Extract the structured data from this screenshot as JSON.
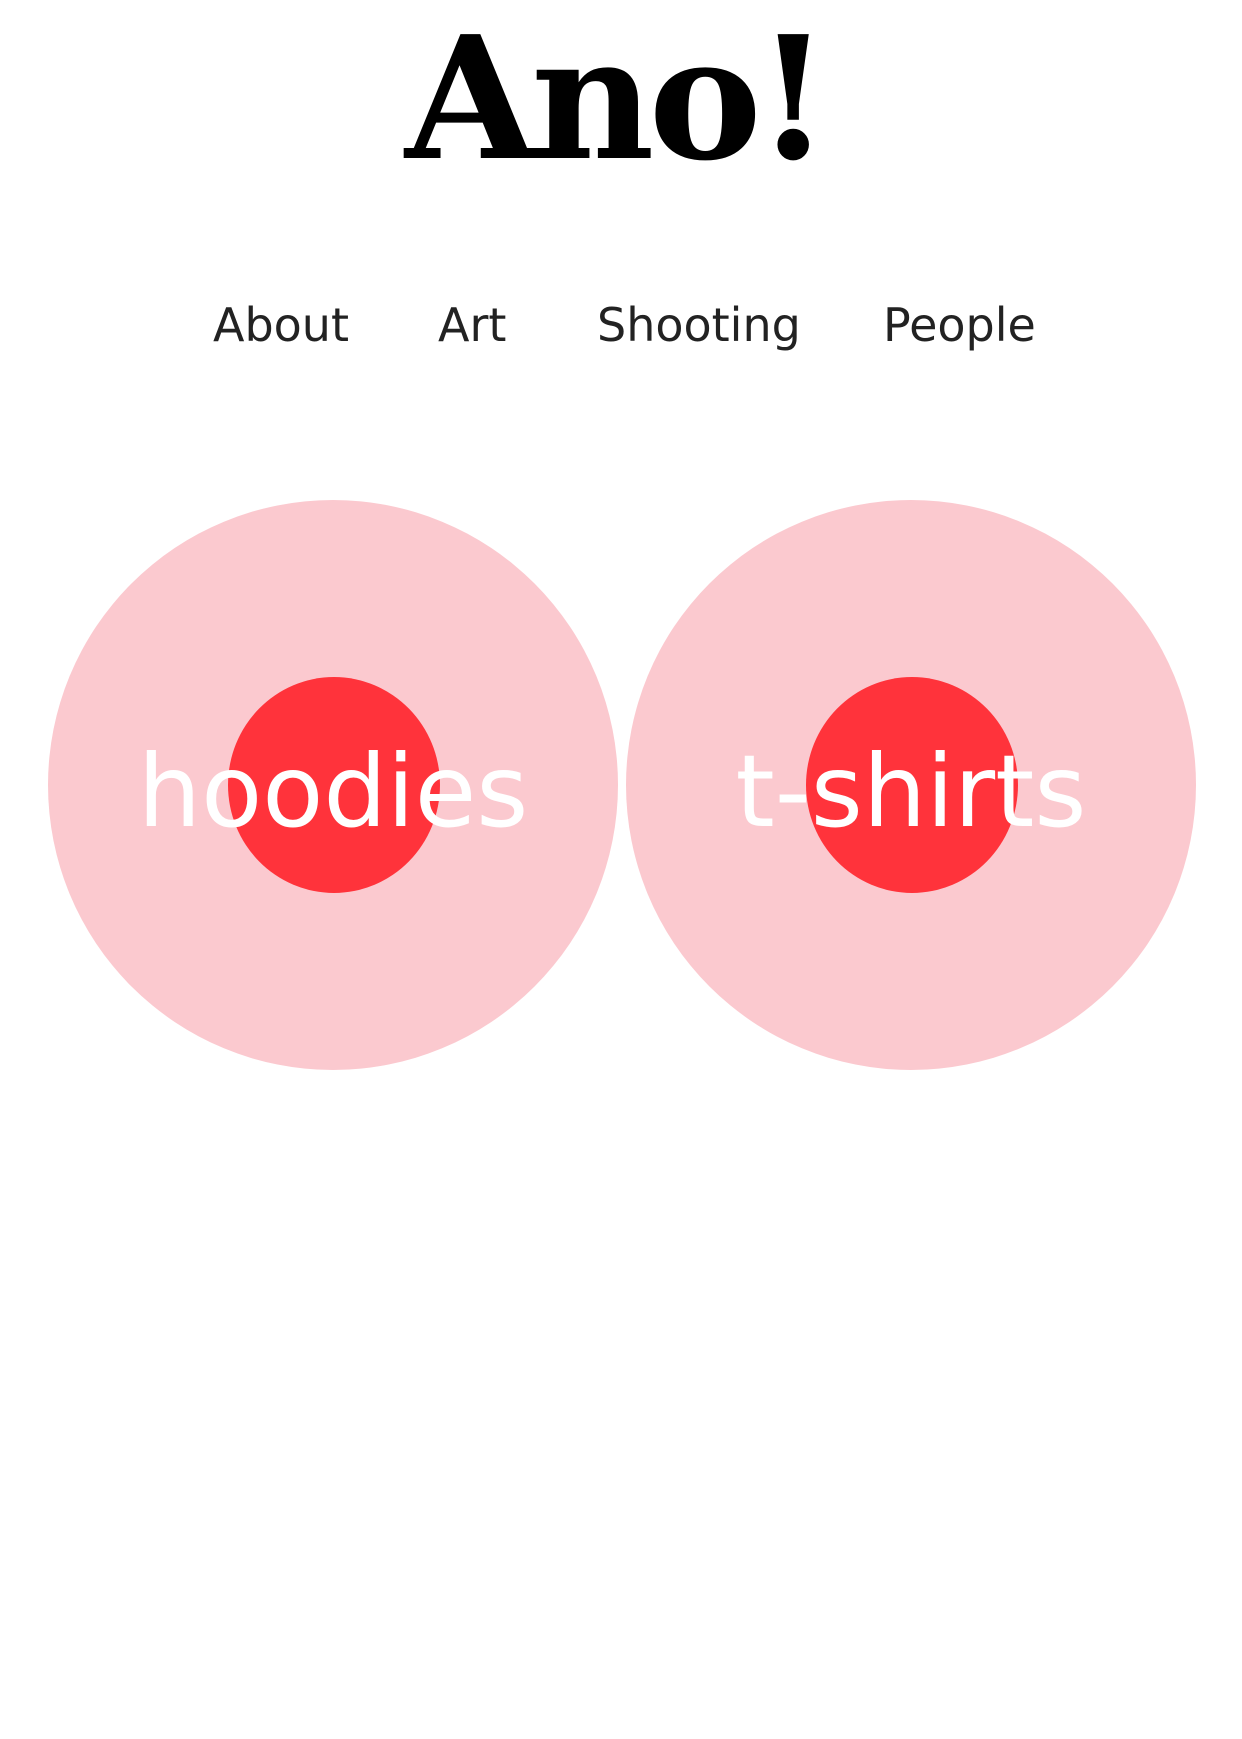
{
  "brand": {
    "logo_text": "Ano!",
    "logo_icon": "exclamation-mark-glyph",
    "text_color": "#000000"
  },
  "nav": {
    "items": [
      {
        "label": "About"
      },
      {
        "label": "Art"
      },
      {
        "label": "Shooting"
      },
      {
        "label": "People"
      }
    ],
    "text_color": "#222222"
  },
  "categories": [
    {
      "label": "hoodies",
      "outer_color": "#fbc9cf",
      "inner_color": "#ff333b"
    },
    {
      "label": "t-shirts",
      "outer_color": "#fbc9cf",
      "inner_color": "#ff333b"
    }
  ]
}
